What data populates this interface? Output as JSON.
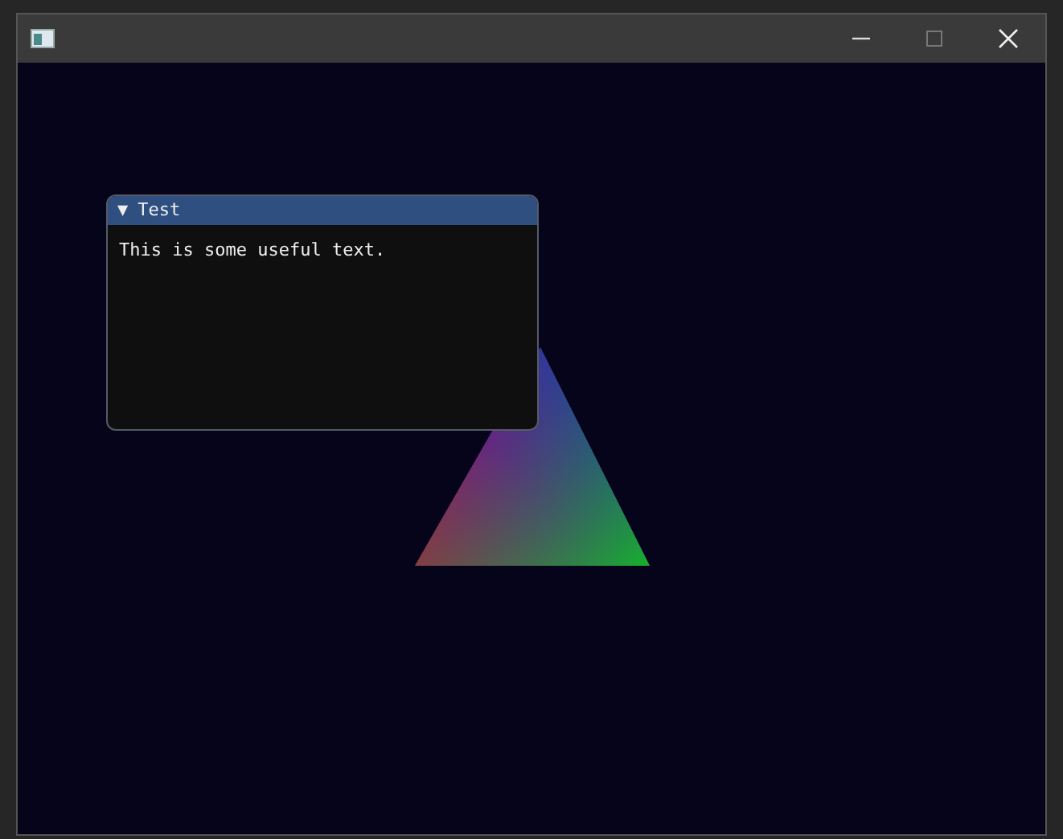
{
  "panel": {
    "title": "Test",
    "toggle": "▼",
    "expanded": true,
    "text": "This is some useful text."
  }
}
